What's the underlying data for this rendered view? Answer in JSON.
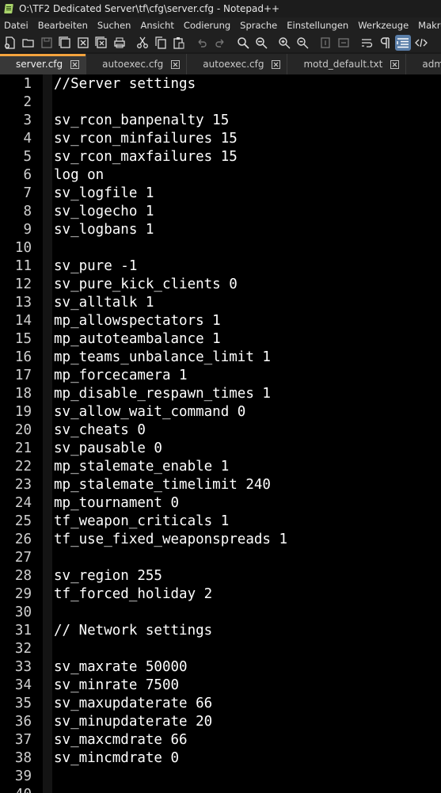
{
  "window": {
    "title": "O:\\TF2 Dedicated Server\\tf\\cfg\\server.cfg - Notepad++"
  },
  "menu": [
    "Datei",
    "Bearbeiten",
    "Suchen",
    "Ansicht",
    "Codierung",
    "Sprache",
    "Einstellungen",
    "Werkzeuge",
    "Makros"
  ],
  "tabs": [
    {
      "label": "server.cfg",
      "active": true
    },
    {
      "label": "autoexec.cfg",
      "active": false
    },
    {
      "label": "autoexec.cfg",
      "active": false
    },
    {
      "label": "motd_default.txt",
      "active": false
    },
    {
      "label": "admins.cfg",
      "active": false
    }
  ],
  "editor": {
    "lines": [
      "//Server settings",
      "",
      "sv_rcon_banpenalty 15",
      "sv_rcon_minfailures 15",
      "sv_rcon_maxfailures 15",
      "log on",
      "sv_logfile 1",
      "sv_logecho 1",
      "sv_logbans 1",
      "",
      "sv_pure -1",
      "sv_pure_kick_clients 0",
      "sv_alltalk 1",
      "mp_allowspectators 1",
      "mp_autoteambalance 1",
      "mp_teams_unbalance_limit 1",
      "mp_forcecamera 1",
      "mp_disable_respawn_times 1",
      "sv_allow_wait_command 0",
      "sv_cheats 0",
      "sv_pausable 0",
      "mp_stalemate_enable 1",
      "mp_stalemate_timelimit 240",
      "mp_tournament 0",
      "tf_weapon_criticals 1",
      "tf_use_fixed_weaponspreads 1",
      "",
      "sv_region 255",
      "tf_forced_holiday 2",
      "",
      "// Network settings",
      "",
      "sv_maxrate 50000",
      "sv_minrate 7500",
      "sv_maxupdaterate 66",
      "sv_minupdaterate 20",
      "sv_maxcmdrate 66",
      "sv_mincmdrate 0",
      "",
      ""
    ]
  },
  "colors": {
    "background": "#000000",
    "text": "#ffffff",
    "line_numbers": "#d0d0d0",
    "active_tab_accent": "#f5a33d"
  }
}
